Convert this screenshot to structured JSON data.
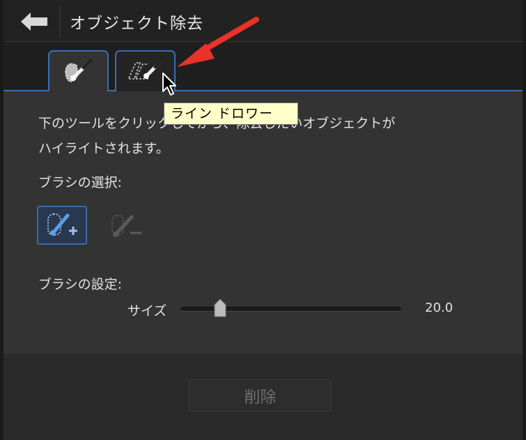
{
  "header": {
    "title": "オブジェクト除去",
    "back_icon": "back-arrow-icon"
  },
  "tabs": [
    {
      "name": "smart-brush",
      "icon": "brush-selection-icon",
      "active": true
    },
    {
      "name": "line-drawer",
      "icon": "line-drawer-icon",
      "active": false
    }
  ],
  "tooltip": "ライン ドロワー",
  "description_lines": [
    "下のツールをクリックしてから、除去したいオブジェクトが",
    "ハイライトされます。"
  ],
  "brush_selection": {
    "label": "ブラシの選択:",
    "buttons": [
      {
        "name": "add-brush",
        "icon": "brush-add-icon",
        "active": true
      },
      {
        "name": "subtract-brush",
        "icon": "brush-subtract-icon",
        "active": false
      }
    ]
  },
  "brush_settings": {
    "label": "ブラシの設定:",
    "size_label": "サイズ",
    "size_value": "20.0",
    "size_fraction": 0.2
  },
  "footer": {
    "delete_label": "削除"
  },
  "colors": {
    "accent": "#3a6fb0",
    "annotation_arrow": "#e8322a",
    "tooltip_bg": "#fefec8"
  }
}
